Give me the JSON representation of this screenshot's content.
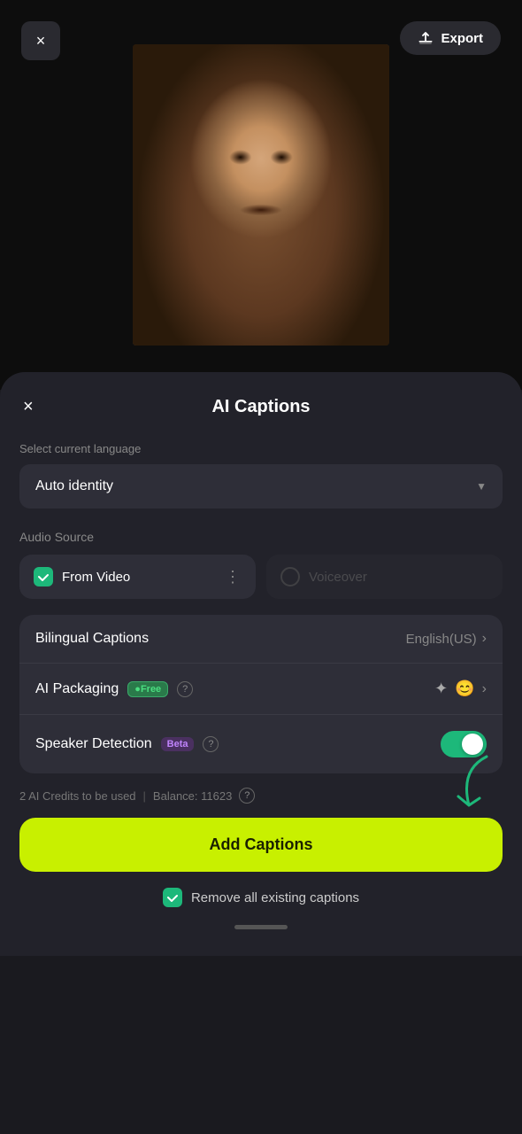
{
  "header": {
    "close_label": "×",
    "export_label": "Export"
  },
  "panel": {
    "close_label": "×",
    "title": "AI Captions",
    "language_section": {
      "label": "Select current language",
      "selected": "Auto identity"
    },
    "audio_source": {
      "label": "Audio Source",
      "options": [
        {
          "id": "from_video",
          "label": "From Video",
          "active": true
        },
        {
          "id": "voiceover",
          "label": "Voiceover",
          "active": false
        }
      ]
    },
    "bilingual": {
      "label": "Bilingual Captions",
      "value": "English(US)"
    },
    "ai_packaging": {
      "label": "AI Packaging",
      "badge": "Free"
    },
    "speaker_detection": {
      "label": "Speaker Detection",
      "badge": "Beta",
      "enabled": true
    },
    "credits": {
      "text": "2 AI Credits to be used",
      "balance_label": "Balance: 11623"
    },
    "add_button_label": "Add Captions",
    "remove_label": "Remove all existing captions"
  }
}
